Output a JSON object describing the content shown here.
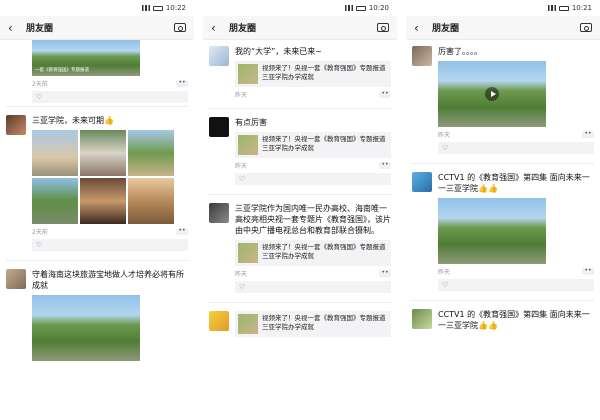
{
  "status_bar": [
    {
      "time": "10:22"
    },
    {
      "time": "10:20"
    },
    {
      "time": "10:21"
    }
  ],
  "nav": {
    "title": "朋友圈"
  },
  "panel0": {
    "top_image_caption": "一套《教育强国》专题报道",
    "top_time": "2天前",
    "post1": {
      "text": "三亚学院，未来可期👍",
      "time": "2天前"
    },
    "post2": {
      "text": "守着海南这块旅游宝地做人才培养必将有所成就"
    }
  },
  "panel1": {
    "post1": {
      "text": "我的“大学”，未来已来~",
      "link": "视频来了！央视一套《教育强国》专题报道三亚学院办学成就",
      "time": "昨天"
    },
    "post2": {
      "text": "有点厉害",
      "link": "视频来了！央视一套《教育强国》专题报道三亚学院办学成就",
      "time": "昨天"
    },
    "post3": {
      "text": "三亚学院作为国内唯一民办高校、海南唯一高校亮相央视一套专题片《教育强国》，该片由中央广播电视总台和教育部联合摄制。",
      "link": "视频来了！央视一套《教育强国》专题报道三亚学院办学成就",
      "time": "昨天"
    },
    "post4": {
      "link": "视频来了！央视一套《教育强国》专题报道三亚学院办学成就"
    }
  },
  "panel2": {
    "post1": {
      "text": "厉害了。。。。",
      "time": "昨天"
    },
    "post2": {
      "text": "CCTV1 的《教育强国》第四集 面向未来一一三亚学院👍👍",
      "time": "昨天"
    },
    "post3": {
      "text": "CCTV1 的《教育强国》第四集 面向未来一一三亚学院👍👍"
    }
  }
}
